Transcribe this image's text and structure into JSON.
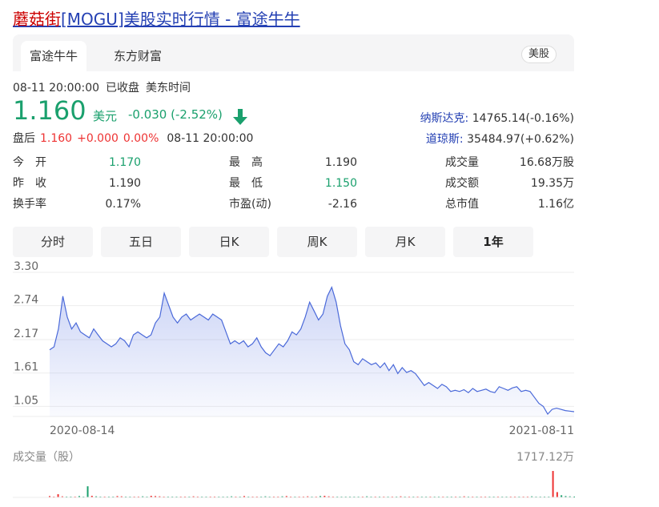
{
  "page_title": {
    "name": "蘑菇街",
    "rest": "[MOGU]美股实时行情 - 富途牛牛"
  },
  "tabs": [
    {
      "label": "富途牛牛",
      "active": true
    },
    {
      "label": "东方财富",
      "active": false
    }
  ],
  "market_tag": "美股",
  "meta": {
    "time": "08-11 20:00:00",
    "status": "已收盘",
    "tz": "美东时间"
  },
  "quote": {
    "price": "1.160",
    "currency": "美元",
    "change": "-0.030 (-2.52%)",
    "color": "#1aa06d"
  },
  "after_hours": {
    "label": "盘后",
    "price": "1.160",
    "change": "+0.000",
    "pct": "0.00%",
    "time": "08-11 20:00:00"
  },
  "indices": [
    {
      "name": "纳斯达克:",
      "value": "14765.14(-0.16%)"
    },
    {
      "name": "道琼斯:",
      "value": "35484.97(+0.62%)"
    }
  ],
  "stats": [
    {
      "key": "今　开",
      "value": "1.170",
      "color": "#1aa06d"
    },
    {
      "key": "最　高",
      "value": "1.190",
      "color": "#333333"
    },
    {
      "key": "成交量",
      "value": "16.68万股",
      "color": "#333333"
    },
    {
      "key": "昨　收",
      "value": "1.190",
      "color": "#333333"
    },
    {
      "key": "最　低",
      "value": "1.150",
      "color": "#1aa06d"
    },
    {
      "key": "成交额",
      "value": "19.35万",
      "color": "#333333"
    },
    {
      "key": "换手率",
      "value": "0.17%",
      "color": "#333333"
    },
    {
      "key": "市盈(动)",
      "value": "-2.16",
      "color": "#333333"
    },
    {
      "key": "总市值",
      "value": "1.16亿",
      "color": "#333333"
    }
  ],
  "period_buttons": [
    {
      "label": "分时",
      "active": false
    },
    {
      "label": "五日",
      "active": false
    },
    {
      "label": "日K",
      "active": false
    },
    {
      "label": "周K",
      "active": false
    },
    {
      "label": "月K",
      "active": false
    },
    {
      "label": "1年",
      "active": true
    }
  ],
  "chart_data": {
    "type": "area",
    "y_ticks": [
      "3.30",
      "2.74",
      "2.17",
      "1.61",
      "1.05"
    ],
    "ylim": [
      0.88,
      3.3
    ],
    "x_labels": [
      "2020-08-14",
      "2021-08-11"
    ],
    "grid": true,
    "series": [
      {
        "values": [
          2.0,
          2.05,
          2.35,
          2.9,
          2.55,
          2.35,
          2.45,
          2.3,
          2.25,
          2.2,
          2.35,
          2.25,
          2.15,
          2.1,
          2.05,
          2.1,
          2.2,
          2.15,
          2.05,
          2.25,
          2.3,
          2.25,
          2.2,
          2.25,
          2.45,
          2.55,
          2.95,
          2.75,
          2.55,
          2.45,
          2.55,
          2.6,
          2.5,
          2.55,
          2.6,
          2.55,
          2.5,
          2.6,
          2.55,
          2.5,
          2.3,
          2.1,
          2.15,
          2.1,
          2.15,
          2.05,
          2.1,
          2.2,
          2.05,
          1.95,
          1.9,
          2.0,
          2.1,
          2.05,
          2.15,
          2.3,
          2.25,
          2.35,
          2.55,
          2.8,
          2.65,
          2.5,
          2.6,
          2.9,
          3.05,
          2.8,
          2.4,
          2.1,
          2.0,
          1.8,
          1.75,
          1.85,
          1.8,
          1.75,
          1.78,
          1.7,
          1.78,
          1.65,
          1.75,
          1.6,
          1.7,
          1.62,
          1.65,
          1.6,
          1.5,
          1.4,
          1.45,
          1.4,
          1.35,
          1.42,
          1.38,
          1.3,
          1.32,
          1.3,
          1.33,
          1.28,
          1.35,
          1.3,
          1.32,
          1.34,
          1.3,
          1.28,
          1.38,
          1.35,
          1.32,
          1.36,
          1.38,
          1.3,
          1.32,
          1.3,
          1.2,
          1.1,
          1.05,
          0.92,
          1.0,
          1.02,
          1.0,
          0.98,
          0.97,
          0.96
        ]
      }
    ],
    "color": "#4a69d9"
  },
  "volume": {
    "label": "成交量（股）",
    "max_label": "1717.12万",
    "values": [
      0.05,
      0.03,
      0.12,
      0.04,
      0.03,
      0.03,
      0.02,
      0.05,
      0.02,
      0.42,
      0.06,
      0.04,
      0.03,
      0.03,
      0.02,
      0.03,
      0.05,
      0.04,
      0.03,
      0.03,
      0.02,
      0.03,
      0.04,
      0.03,
      0.06,
      0.05,
      0.04,
      0.03,
      0.03,
      0.02,
      0.03,
      0.03,
      0.02,
      0.03,
      0.04,
      0.03,
      0.03,
      0.02,
      0.03,
      0.02,
      0.03,
      0.03,
      0.02,
      0.04,
      0.03,
      0.03,
      0.05,
      0.03,
      0.03,
      0.02,
      0.03,
      0.04,
      0.03,
      0.03,
      0.02,
      0.04,
      0.05,
      0.03,
      0.03,
      0.02,
      0.03,
      0.04,
      0.03,
      0.02,
      0.05,
      0.06,
      0.04,
      0.03,
      0.02,
      0.03,
      0.03,
      0.02,
      0.03,
      0.03,
      0.02,
      0.04,
      0.03,
      0.02,
      0.03,
      0.03,
      0.02,
      0.02,
      0.03,
      0.04,
      0.02,
      0.03,
      0.02,
      0.03,
      0.02,
      0.03,
      0.02,
      0.02,
      0.03,
      0.02,
      0.03,
      0.02,
      0.02,
      0.03,
      0.04,
      0.02,
      0.03,
      0.02,
      0.02,
      0.03,
      0.02,
      0.03,
      0.02,
      0.02,
      0.03,
      0.02,
      0.03,
      0.03,
      0.02,
      0.03,
      0.04,
      0.02,
      0.03,
      0.02,
      0.03,
      1.0,
      0.2,
      0.08,
      0.05,
      0.04,
      0.03
    ],
    "colors": {
      "up": "#e33",
      "down": "#1aa06d"
    }
  }
}
